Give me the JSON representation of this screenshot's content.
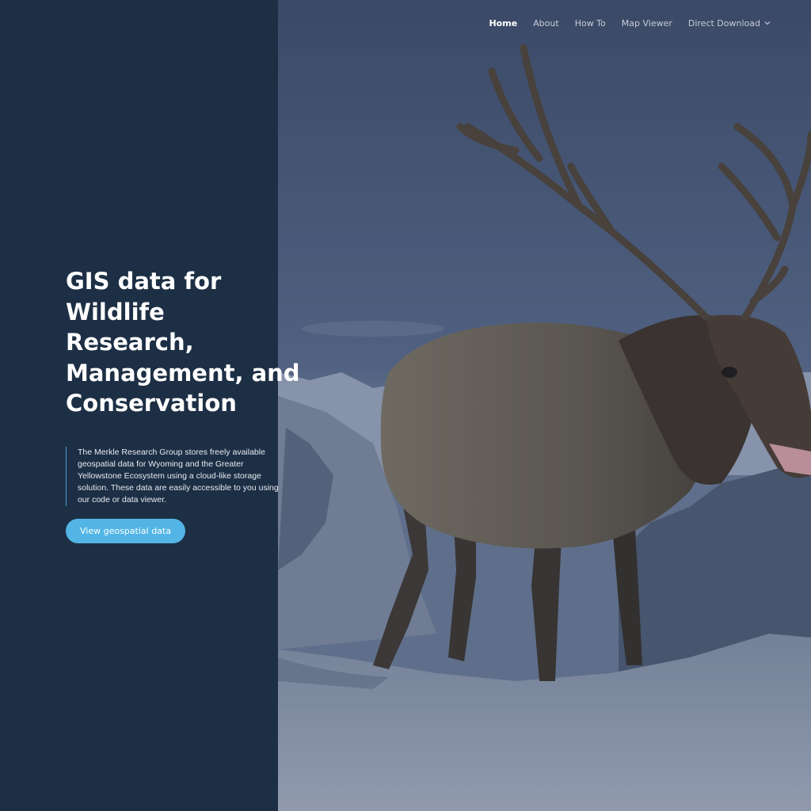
{
  "nav": {
    "items": [
      {
        "label": "Home",
        "active": true
      },
      {
        "label": "About",
        "active": false
      },
      {
        "label": "How To",
        "active": false
      },
      {
        "label": "Map Viewer",
        "active": false
      },
      {
        "label": "Direct Download",
        "active": false,
        "dropdown": true
      }
    ]
  },
  "hero": {
    "headline_lines": [
      "GIS data for",
      "Wildlife",
      "Research,",
      "Management, and",
      "Conservation"
    ],
    "description": "The Merkle Research Group stores freely available geospatial data for Wyoming and the Greater Yellowstone Ecosystem using a cloud-like storage solution. These data are easily accessible to you using our code or data viewer.",
    "cta_label": "View geospatial data",
    "image_subject": "bull elk walking through snowy mountain landscape"
  },
  "colors": {
    "panel_bg": "#1d2f45",
    "accent": "#52b5e6",
    "border_accent": "#4a9fd4",
    "nav_text": "#c6ccd6"
  }
}
